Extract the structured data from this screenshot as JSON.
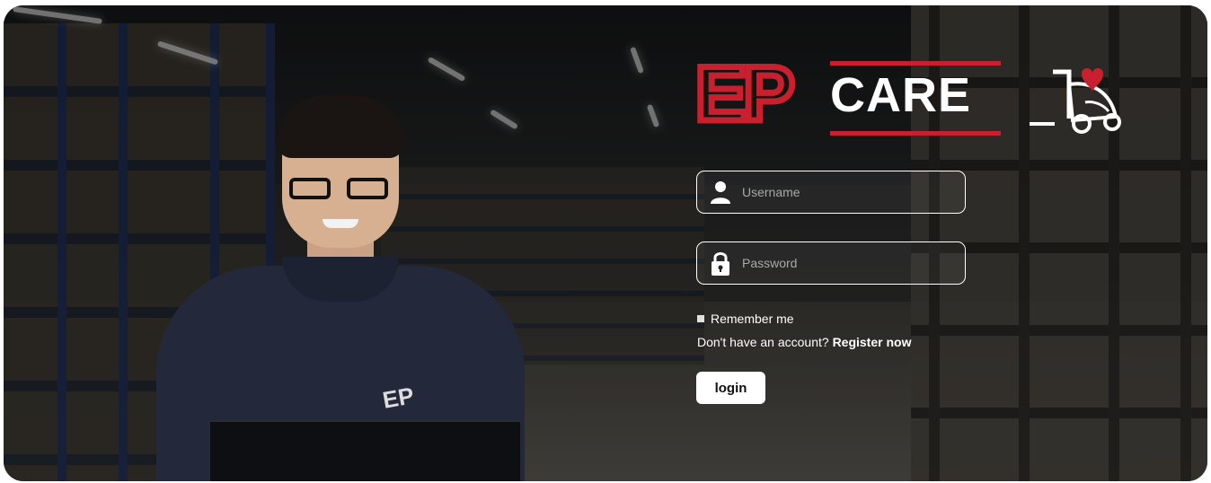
{
  "brand": {
    "logo_text_left": "EP",
    "logo_text_right": "CARE",
    "accent_color": "#c8202f"
  },
  "form": {
    "username_placeholder": "Username",
    "password_placeholder": "Password",
    "username_icon": "user-icon",
    "password_icon": "lock-icon",
    "remember_label": "Remember me",
    "register_prompt": "Don't have an account?",
    "register_link": "Register now",
    "login_label": "login"
  }
}
